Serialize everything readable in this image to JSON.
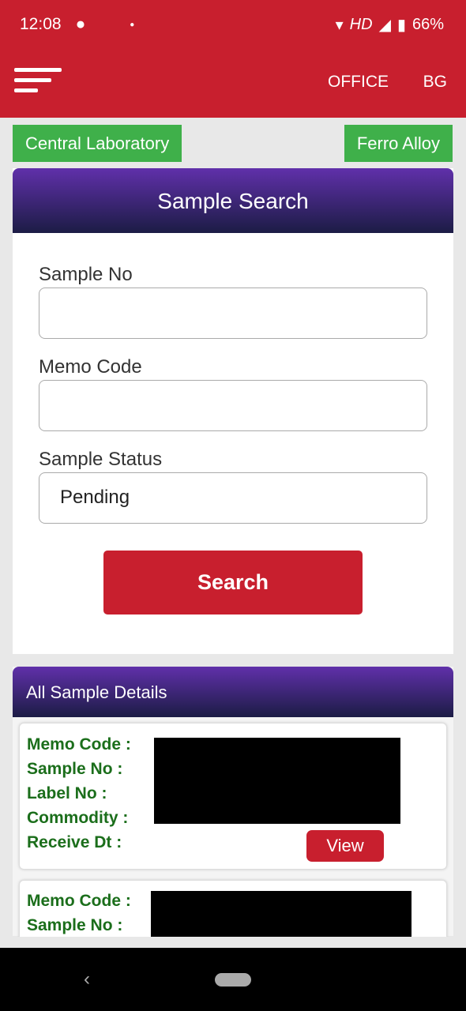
{
  "status_bar": {
    "time": "12:08",
    "network": "HD",
    "battery": "66%"
  },
  "app_bar": {
    "office_label": "OFFICE",
    "bg_label": "BG"
  },
  "tags": {
    "lab": "Central  Laboratory",
    "category": "Ferro Alloy"
  },
  "search": {
    "title": "Sample Search",
    "sample_no_label": "Sample No",
    "sample_no_value": "",
    "memo_code_label": "Memo Code",
    "memo_code_value": "",
    "status_label": "Sample Status",
    "status_value": "Pending",
    "search_button": "Search"
  },
  "details": {
    "title": "All Sample Details",
    "fields": {
      "memo": "Memo Code :",
      "sample": "Sample No :",
      "label": "Label No  :",
      "commodity": "Commodity :",
      "receive": "Receive Dt  :"
    },
    "view_button": "View"
  },
  "colors": {
    "primary": "#c81f2e",
    "tag": "#3fb04a",
    "label": "#1b6e1b"
  }
}
